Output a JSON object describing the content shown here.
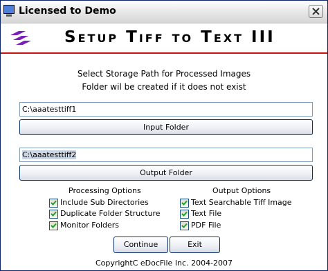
{
  "window": {
    "title": "Licensed to Demo"
  },
  "banner": {
    "title": "Setup Tiff to Text III"
  },
  "instructions": {
    "line1": "Select Storage Path for Processed Images",
    "line2": "Folder wil be created if it does not exist"
  },
  "input_path": {
    "value": "C:\\aaatesttiff1"
  },
  "input_button": {
    "label": "Input Folder"
  },
  "output_path": {
    "value": "C:\\aaatesttiff2"
  },
  "output_button": {
    "label": "Output Folder"
  },
  "processing_options": {
    "heading": "Processing Options",
    "items": [
      {
        "label": "Include Sub Directories",
        "checked": true
      },
      {
        "label": "Duplicate Folder Structure",
        "checked": true
      },
      {
        "label": "Monitor Folders",
        "checked": true
      }
    ]
  },
  "output_options": {
    "heading": "Output Options",
    "items": [
      {
        "label": "Text Searchable Tiff Image",
        "checked": true
      },
      {
        "label": "Text File",
        "checked": true
      },
      {
        "label": "PDF File",
        "checked": true
      }
    ]
  },
  "buttons": {
    "continue_label": "Continue",
    "exit_label": "Exit"
  },
  "footer": {
    "copyright": "CopyrightC eDocFile Inc. 2004-2007"
  },
  "colors": {
    "accent_red": "#c81010",
    "logo_purple": "#7a1fb8",
    "button_border": "#0a2f6c"
  }
}
